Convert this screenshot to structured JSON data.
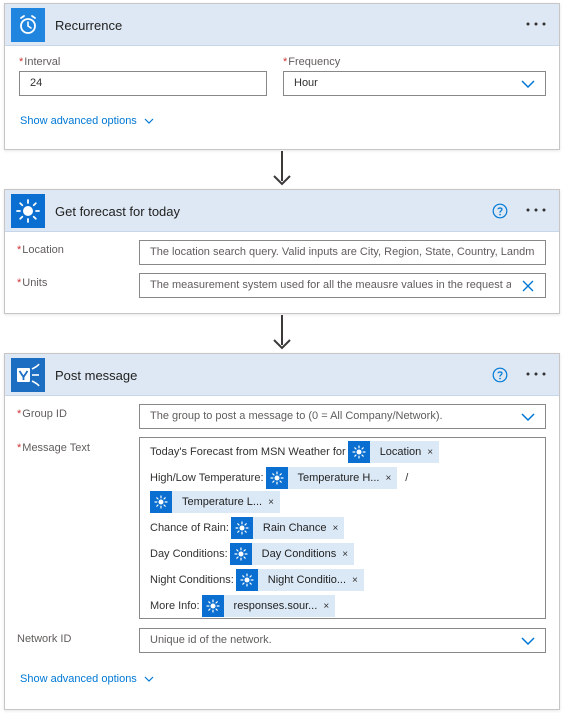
{
  "colors": {
    "header_bg": "#dde8f4",
    "accent": "#0078d4",
    "token_bg": "#dbe9f7",
    "token_icon_bg": "#0a6fd0",
    "required_marker": "#d13438"
  },
  "recurrence": {
    "title": "Recurrence",
    "icon": "alarm-clock-icon",
    "more": "...",
    "interval_label": "Interval",
    "interval_value": "24",
    "frequency_label": "Frequency",
    "frequency_value": "Hour",
    "advanced_link": "Show advanced options"
  },
  "forecast": {
    "title": "Get forecast for today",
    "icon": "sun-icon",
    "more": "...",
    "location_label": "Location",
    "location_placeholder": "The location search query. Valid inputs are City, Region, State, Country, Landma",
    "units_label": "Units",
    "units_placeholder": "The measurement system used for all the meausre values in the request a"
  },
  "post": {
    "title": "Post message",
    "icon": "yammer-icon",
    "more": "...",
    "group_label": "Group ID",
    "group_placeholder": "The group to post a message to (0 = All Company/Network).",
    "message_label": "Message Text",
    "message": {
      "line1_text": "Today's Forecast from MSN Weather for",
      "line1_token": "Location",
      "line2_text": "High/Low Temperature:",
      "line2_token": "Temperature H...",
      "line2_sep": "/",
      "line3_token": "Temperature L...",
      "line4_text": "Chance of Rain:",
      "line4_token": "Rain Chance",
      "line5_text": "Day Conditions:",
      "line5_token": "Day Conditions",
      "line6_text": "Night Conditions:",
      "line6_token": "Night Conditio...",
      "line7_text": "More Info:",
      "line7_token": "responses.sour...",
      "remove": "×"
    },
    "network_label": "Network ID",
    "network_placeholder": "Unique id of the network.",
    "advanced_link": "Show advanced options"
  }
}
